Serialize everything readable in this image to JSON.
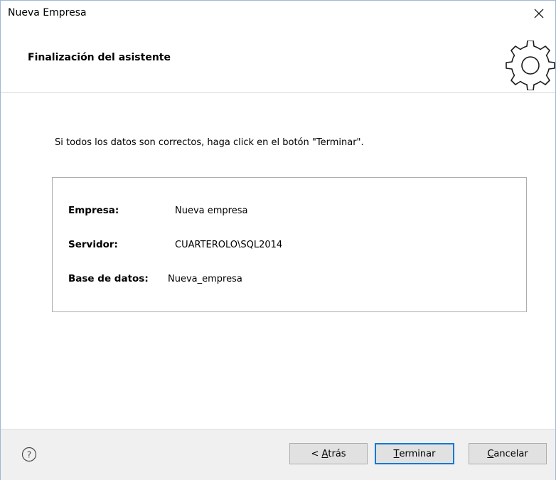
{
  "window": {
    "title": "Nueva Empresa",
    "close_label": "×"
  },
  "header": {
    "title": "Finalización del asistente",
    "icon": "gear-icon"
  },
  "content": {
    "instruction": "Si todos los datos son correctos, haga click en el botón \"Terminar\".",
    "summary": {
      "empresa_label": "Empresa:",
      "empresa_value": "Nueva empresa",
      "servidor_label": "Servidor:",
      "servidor_value": "CUARTEROLO\\SQL2014",
      "base_label": "Base de datos:",
      "base_value": "Nueva_empresa"
    }
  },
  "footer": {
    "help_icon": "help-icon",
    "back": {
      "prefix": "< ",
      "accel": "A",
      "rest": "trás"
    },
    "finish": {
      "accel": "T",
      "rest": "erminar"
    },
    "cancel": {
      "accel": "C",
      "rest": "ancelar"
    }
  },
  "colors": {
    "accent": "#0078d7",
    "footer_bg": "#f0f0f0",
    "button_bg": "#e1e1e1"
  }
}
